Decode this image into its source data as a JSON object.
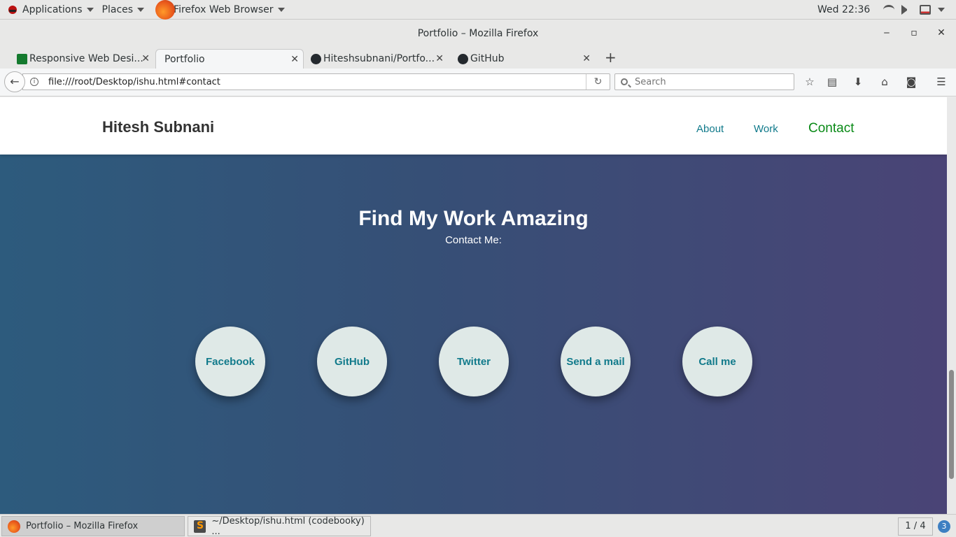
{
  "topbar": {
    "applications": "Applications",
    "places": "Places",
    "app_name": "Firefox Web Browser",
    "clock": "Wed 22:36"
  },
  "window": {
    "title": "Portfolio – Mozilla Firefox",
    "minimize": "‒",
    "maximize": "▫",
    "close": "✕"
  },
  "tabs": [
    {
      "label": "Responsive Web Desi...",
      "icon": "green-page-icon",
      "close": "✕"
    },
    {
      "label": "Portfolio",
      "icon": "",
      "close": "✕"
    },
    {
      "label": "Hiteshsubnani/Portfo...",
      "icon": "github-icon",
      "close": "✕"
    },
    {
      "label": "GitHub",
      "icon": "github-icon",
      "close": "✕"
    }
  ],
  "new_tab": "+",
  "navbar": {
    "back": "←",
    "url": "file:///root/Desktop/ishu.html#contact",
    "reload": "↻",
    "search_placeholder": "Search"
  },
  "toolbar_icons": [
    "star-icon",
    "reading-list-icon",
    "download-icon",
    "home-icon",
    "pocket-icon",
    "menu-icon"
  ],
  "site": {
    "brand": "Hitesh Subnani",
    "nav": {
      "about": "About",
      "work": "Work",
      "contact": "Contact"
    },
    "heading": "Find My Work Amazing",
    "subheading": "Contact Me:",
    "buttons": {
      "facebook": "Facebook",
      "github": "GitHub",
      "twitter": "Twitter",
      "mail": "Send a mail",
      "call": "Call me"
    }
  },
  "taskbar": {
    "task1": "Portfolio – Mozilla Firefox",
    "task2": "~/Desktop/ishu.html (codebooky) ...",
    "pager": "1 / 4",
    "notifications": "3"
  },
  "colors": {
    "link": "#117a8b",
    "active_link": "#0a8a17",
    "gradient_left": "#2d5b7d",
    "gradient_right": "#4a4476",
    "circle": "#dfe9e7"
  }
}
